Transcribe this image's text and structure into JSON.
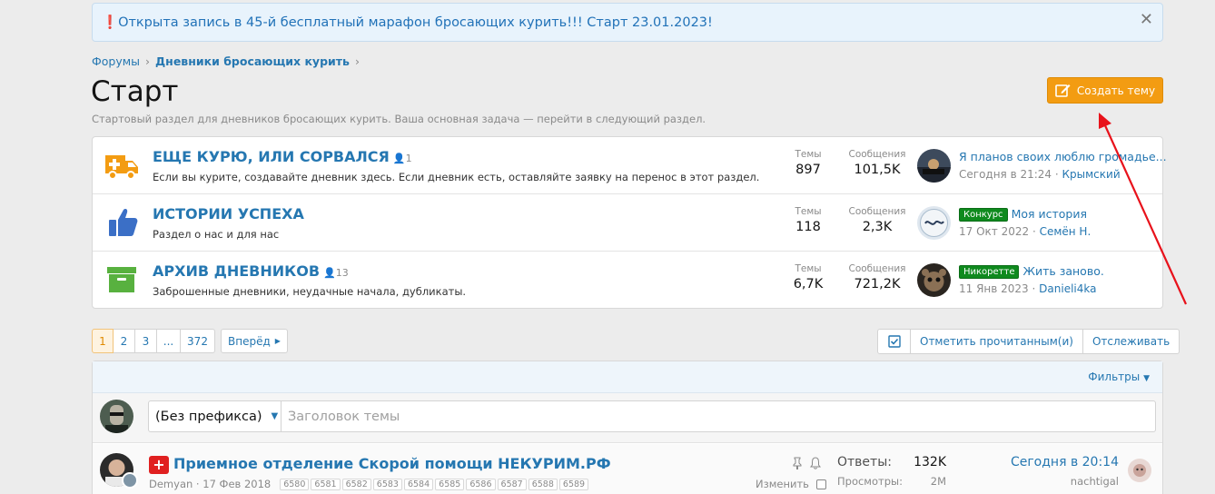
{
  "notice": {
    "text": "Открыта запись в 45-й бесплатный марафон бросающих курить!!! Старт 23.01.2023!",
    "close": "✕"
  },
  "breadcrumb": {
    "items": [
      "Форумы",
      "Дневники бросающих курить"
    ]
  },
  "page": {
    "title": "Старт",
    "description": "Стартовый раздел для дневников бросающих курить. Ваша основная задача — перейти в следующий раздел."
  },
  "create_button": {
    "label": "Создать тему"
  },
  "stats_labels": {
    "topics": "Темы",
    "messages": "Сообщения"
  },
  "nodes": [
    {
      "title": "ЕЩЕ КУРЮ, ИЛИ СОРВАЛСЯ",
      "users": "1",
      "description": "Если вы курите, создавайте дневник здесь. Если дневник есть, оставляйте заявку на перенос в этот раздел.",
      "topics": "897",
      "messages": "101,5K",
      "last_prefix": "",
      "last_title": "Я планов своих люблю громадье...",
      "last_time": "Сегодня в 21:24",
      "last_user": "Крымский",
      "icon": "ambulance-icon",
      "color": "#f39c12"
    },
    {
      "title": "ИСТОРИИ УСПЕХА",
      "users": "",
      "description": "Раздел о нас и для нас",
      "topics": "118",
      "messages": "2,3K",
      "last_prefix": "Конкурс",
      "last_title": "Моя история",
      "last_time": "17 Окт 2022",
      "last_user": "Семён Н.",
      "icon": "thumbs-up-icon",
      "color": "#3b6fc6"
    },
    {
      "title": "АРХИВ ДНЕВНИКОВ",
      "users": "13",
      "description": "Заброшенные дневники, неудачные начала, дубликаты.",
      "topics": "6,7K",
      "messages": "721,2K",
      "last_prefix": "Никоретте",
      "last_title": "Жить заново.",
      "last_time": "11 Янв 2023",
      "last_user": "Danieli4ka",
      "icon": "archive-icon",
      "color": "#58b13f"
    }
  ],
  "pagination": {
    "pages": [
      "1",
      "2",
      "3",
      "...",
      "372"
    ],
    "current": "1",
    "next": "Вперёд"
  },
  "actions": {
    "mark_read": "Отметить прочитанным(и)",
    "watch": "Отслеживать"
  },
  "filters": {
    "label": "Фильтры"
  },
  "quick_thread": {
    "prefix": "(Без префикса)",
    "placeholder": "Заголовок темы"
  },
  "thread": {
    "title": "Приемное отделение Скорой помощи НЕКУРИМ.РФ",
    "author": "Demyan",
    "date": "17 Фев 2018",
    "pages": [
      "6580",
      "6581",
      "6582",
      "6583",
      "6584",
      "6585",
      "6586",
      "6587",
      "6588",
      "6589"
    ],
    "edit": "Изменить",
    "replies_label": "Ответы:",
    "replies": "132K",
    "views_label": "Просмотры:",
    "views": "2M",
    "last_time": "Сегодня в 20:14",
    "last_user": "nachtigal"
  },
  "colors": {
    "accent": "#2577b1",
    "create": "#f39c12",
    "arrow": "#e8121b"
  }
}
